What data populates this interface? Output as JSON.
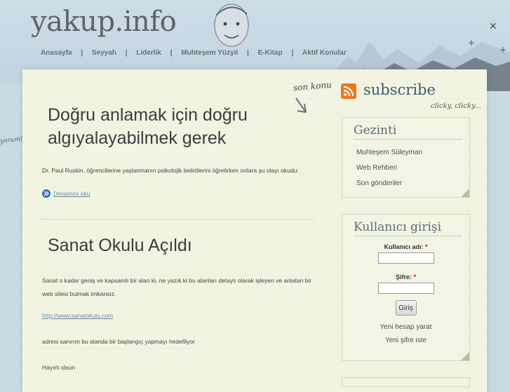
{
  "site": {
    "title": "yakup.info"
  },
  "nav": {
    "items": [
      {
        "label": "Anasayfa"
      },
      {
        "label": "Seyyah"
      },
      {
        "label": "Liderlik"
      },
      {
        "label": "Muhteşem Yüzyıl"
      },
      {
        "label": "E-Kitap"
      },
      {
        "label": "Aktif Konular"
      }
    ]
  },
  "decor": {
    "left_scribble": "yorumla",
    "son_konu": "son konu",
    "clicky": "clicky, clicky..."
  },
  "subscribe": {
    "label": "subscribe"
  },
  "posts": [
    {
      "title": "Doğru anlamak için doğru algıyalayabilmek gerek",
      "body": "Dr. Paul Ruskin, öğrencilerine yaşlanmanın psikolojik belirtilerini öğretirken onlara şu olayı okudu:",
      "more": "Devamını oku"
    },
    {
      "title": "Sanat Okulu Açıldı",
      "p1": "Sanat o kadar geniş ve kapsamlı bir alan ki, ne yazık ki bu alanları detaylı olarak işleyen ve anlatan bir web sitesi bulmak imkansız.",
      "link": "http://www.sanatokulu.com",
      "p2": "adresi sanırım bu alanda bir başlangıç yapmayı hedefliyor",
      "p3": "Hayırlı olsun"
    }
  ],
  "sidebar": {
    "nav_block": {
      "title": "Gezinti",
      "items": [
        {
          "label": "Muhteşem Süleyman"
        },
        {
          "label": "Web Rehberi"
        },
        {
          "label": "Son gönderiler"
        }
      ]
    },
    "login_block": {
      "title": "Kullanıcı girişi",
      "username_label": "Kullanıcı adı:",
      "password_label": "Şifre:",
      "required_mark": "*",
      "username_value": "",
      "password_value": "",
      "submit_label": "Giriş",
      "register_link": "Yeni hesap yarat",
      "reset_link": "Yeni şifre iste"
    }
  },
  "colors": {
    "paper": "#f1f4e1",
    "accent": "#46556a",
    "rss": "#e36f15",
    "more_icon": "#2d6fa8"
  }
}
